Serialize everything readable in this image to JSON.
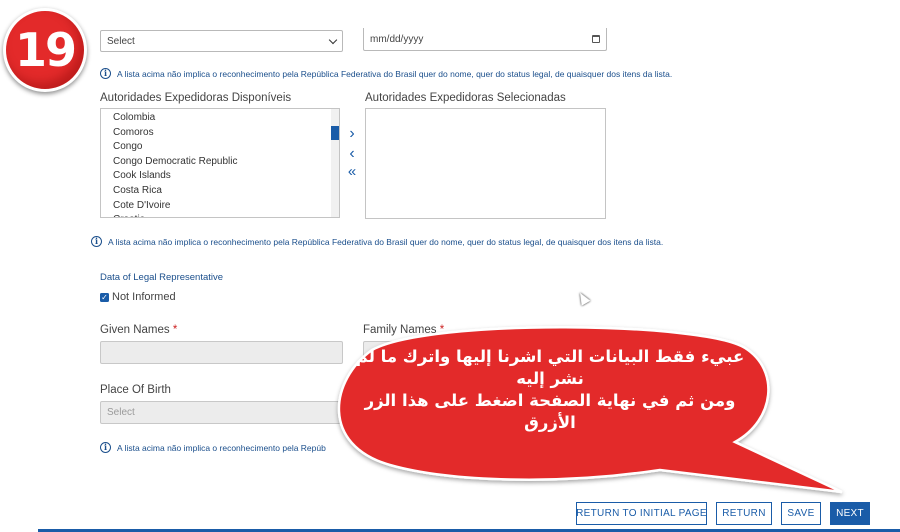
{
  "top_row": {
    "select_value": "Select",
    "date_placeholder": "mm/dd/yyyy"
  },
  "notes": {
    "disclaimer": "A lista acima não implica o reconhecimento pela República Federativa do Brasil quer do nome, quer do status legal, de quaisquer dos itens da lista.",
    "disclaimer_truncated": "A lista acima não implica o reconhecimento pela Repúb"
  },
  "authorities": {
    "available_label": "Autoridades Expedidoras Disponíveis",
    "selected_label": "Autoridades Expedidoras Selecionadas",
    "available_items": [
      "Colombia",
      "Comoros",
      "Congo",
      "Congo Democratic Republic",
      "Cook Islands",
      "Costa Rica",
      "Cote D'Ivoire",
      "Croatia"
    ],
    "selected_items": [],
    "move_right_symbol": "›",
    "move_left_symbol": "‹",
    "move_all_left_symbol": "«"
  },
  "legal_rep": {
    "section_title": "Data of Legal Representative",
    "not_informed_label": "Not Informed",
    "not_informed_checked": true,
    "given_names_label": "Given Names",
    "family_names_label": "Family Names",
    "required_mark": "*",
    "place_of_birth_label": "Place Of Birth",
    "place_of_birth_value": "Select"
  },
  "buttons": {
    "return_initial": "RETURN TO INITIAL PAGE",
    "return": "RETURN",
    "save": "SAVE",
    "next": "NEXT"
  },
  "overlay": {
    "step_number": "19",
    "callout_lines": [
      "عبيء فقط البيانات التي اشرنا إليها واترك ما لم",
      "نشر إليه",
      "ومن ثم في نهاية الصفحة اضغط على هذا الزر",
      "الأزرق"
    ],
    "callout_color": "#e32a2a"
  },
  "colors": {
    "accent": "#1a5ca8",
    "required": "#cc2222",
    "note_text": "#1b4f8c"
  }
}
